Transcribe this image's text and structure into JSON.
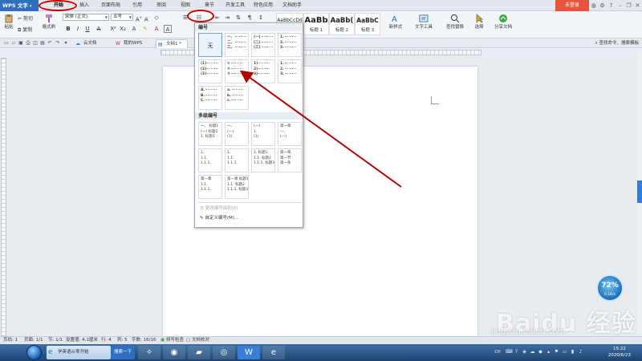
{
  "app": {
    "title": "WPS 文字"
  },
  "menu": {
    "tabs": [
      "开始",
      "插入",
      "页面布局",
      "引用",
      "审阅",
      "视图",
      "章节",
      "开发工具",
      "特色应用",
      "文档助手"
    ],
    "active": "开始"
  },
  "title_right": {
    "login": "未登录"
  },
  "ribbon": {
    "paste": "粘贴",
    "cut": "剪切",
    "copy": "复制",
    "format_painter": "格式刷",
    "font_name": "宋体 (正文)",
    "font_size": "五号",
    "styles": [
      {
        "sample": "AaBbCcDd",
        "name": "正文"
      },
      {
        "sample": "AaBb",
        "name": "标题 1"
      },
      {
        "sample": "AaBb(",
        "name": "标题 2"
      },
      {
        "sample": "AaBbC",
        "name": "标题 3"
      }
    ],
    "new_style": "新样式",
    "text_tools": "文字工具",
    "find_replace": "查找替换",
    "select": "选择",
    "share_doc": "分享文档"
  },
  "doc_tabs": {
    "cloud": "云文档",
    "my_wps": "我的WPS",
    "doc1": "文档1 *",
    "search_cmd": "查找命令、搜索模板"
  },
  "numbering_panel": {
    "header": "编号",
    "none_label": "无",
    "multilevel_header": "多级编号",
    "single_cells": [
      [
        "一、",
        "二、",
        "三、"
      ],
      [
        "(一)",
        "(二)",
        "(三)"
      ],
      [
        "1.",
        "2.",
        "3."
      ],
      [
        "(1)",
        "(2)",
        "(3)"
      ],
      [
        "①",
        "②",
        "③"
      ],
      [
        "1)",
        "2)",
        "3)"
      ],
      [
        "1.",
        "2.",
        "3."
      ],
      [
        "A.",
        "B.",
        "C."
      ],
      [
        "a.",
        "b.",
        "c."
      ]
    ],
    "multilevel_cells": [
      [
        "一、 标题1",
        "(一) 标题2",
        "1. 标题3"
      ],
      [
        "一、",
        "(一)",
        "(1)"
      ],
      [
        "(一)",
        "1.",
        "(1)"
      ],
      [
        "第一章",
        "一、",
        "(一)"
      ],
      [
        "1.",
        "1.1.",
        "1.1.1."
      ],
      [
        "1.",
        "1.1.",
        "1.1.1."
      ],
      [
        "1. 标题1",
        "1.1. 标题2",
        "1.1.1. 标题3"
      ],
      [
        "第一章",
        "第一节",
        "第一条"
      ],
      [
        "第一章",
        "1.1.",
        "1.1.1."
      ],
      [
        "第一章 标题1",
        "1.1. 标题2",
        "1.1.1. 标题3"
      ]
    ],
    "change_level": "更改编号级别(E)",
    "custom": "自定义编号(M)..."
  },
  "status": {
    "page_no": "页码: 1",
    "pages": "页面: 1/1",
    "section": "节: 1/1",
    "setting": "设置值: 4.1厘米",
    "row": "行: 4",
    "col": "列: 5",
    "words": "字数: 16/16",
    "spell": "拼写检查",
    "proof": "文档校对"
  },
  "net_widget": {
    "percent": "72%",
    "speed": "0.1K/s"
  },
  "taskbar": {
    "ie_text": "学英语从零开始",
    "search": "搜索一下",
    "lang": "CH",
    "time": "15:22",
    "date": "2020/6/23"
  },
  "watermark": {
    "text": "Baidu 经验",
    "url": "jingyan.baidu.com"
  },
  "colors": {
    "accent_blue": "#2f6fbe",
    "annotation_red": "#c00000",
    "login_red": "#e8553e"
  }
}
